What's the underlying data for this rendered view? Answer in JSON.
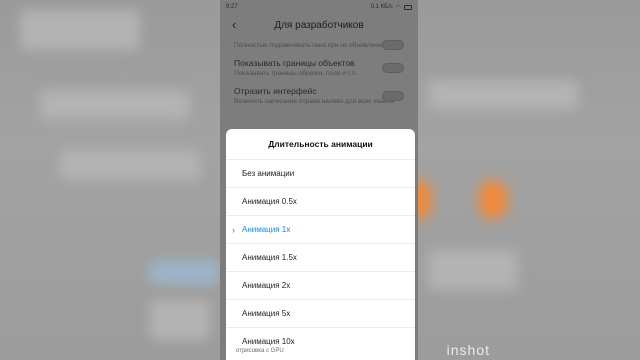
{
  "status_bar": {
    "time": "9:27",
    "network": "0,1 КБ/с"
  },
  "header": {
    "title": "Для разработчиков"
  },
  "settings": [
    {
      "title": "",
      "desc": "Полностью подсвечивать окна при их обновлении"
    },
    {
      "title": "Показывать границы объектов",
      "desc": "Показывать границы обрезки, поля и т.п."
    },
    {
      "title": "Отразить интерфейс",
      "desc": "Включить написание справа налево для всех языков"
    }
  ],
  "dialog": {
    "title": "Длительность анимации",
    "options": [
      "Без анимации",
      "Анимация 0.5x",
      "Анимация 1x",
      "Анимация 1.5x",
      "Анимация 2x",
      "Анимация 5x",
      "Анимация 10x"
    ],
    "selected_index": 2
  },
  "bottom_text": "отрисовка с GPU",
  "watermark": "inshot",
  "colors": {
    "accent": "#1e88e5"
  }
}
